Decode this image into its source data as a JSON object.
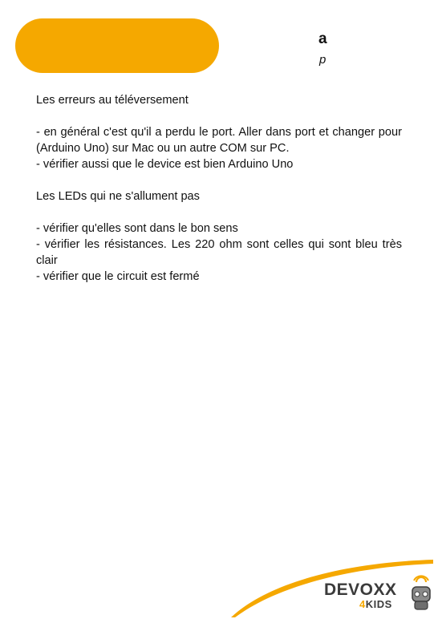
{
  "header": {
    "letter": "a",
    "sub_letter": "p"
  },
  "content": {
    "paragraphs": [
      "Les erreurs au téléversement",
      "",
      "- en général c'est qu'il a perdu le port. Aller dans port et changer pour (Arduino Uno) sur Mac ou un autre COM sur PC.",
      "- vérifier aussi que le device est bien Arduino Uno",
      "",
      "Les LEDs qui ne s'allument pas",
      "",
      "- vérifier qu'elles sont dans le bon sens",
      "- vérifier les résistances. Les 220 ohm sont celles qui sont bleu très clair",
      "- vérifier que le circuit est fermé"
    ]
  },
  "logo": {
    "word": "DEVOXX",
    "sub_digit": "4",
    "sub_word": "KIDS"
  },
  "colors": {
    "accent": "#f5a800",
    "text": "#111111",
    "logo_text": "#3b3b3b"
  }
}
